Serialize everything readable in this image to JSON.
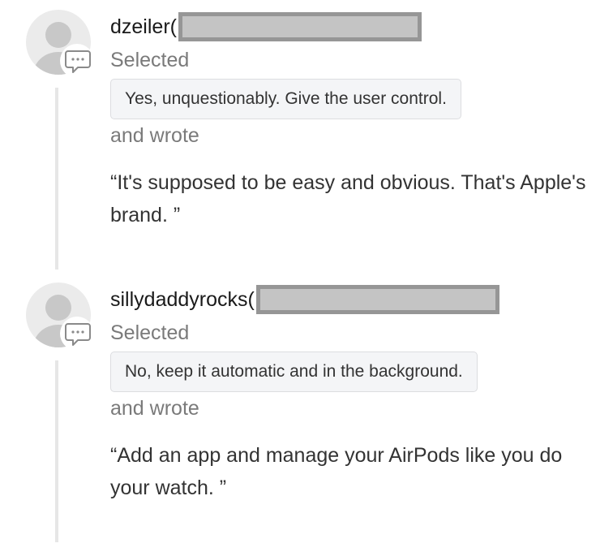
{
  "entries": [
    {
      "username": "dzeiler(",
      "selected_label": "Selected",
      "choice": "Yes, unquestionably. Give the user control.",
      "wrote_label": "and wrote",
      "comment": "“It's supposed to be easy and obvious. That's Apple's brand. ”",
      "avatar_icon": "user-placeholder-icon",
      "badge_icon": "comment-bubble-icon"
    },
    {
      "username": "sillydaddyrocks(",
      "selected_label": "Selected",
      "choice": "No, keep it automatic and in the background.",
      "wrote_label": "and wrote",
      "comment": "“Add an app and manage your AirPods like you do your watch. ”",
      "avatar_icon": "user-placeholder-icon",
      "badge_icon": "comment-bubble-icon"
    }
  ],
  "colors": {
    "avatar_gray": "#c8c8c8",
    "badge_gray": "#8a8a8a",
    "redaction_fill": "#c4c4c4",
    "redaction_border": "#969696",
    "thread_line": "#e6e6e6"
  }
}
